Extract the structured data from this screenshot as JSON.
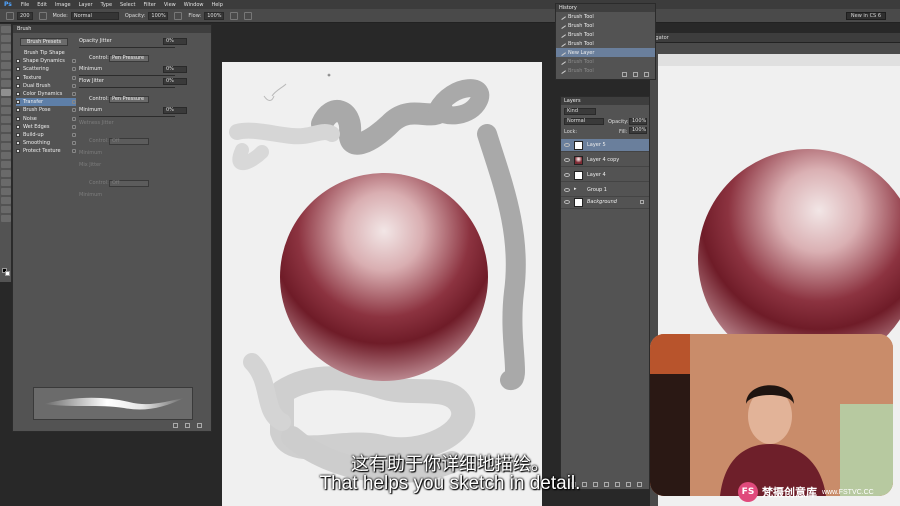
{
  "app": {
    "logo": "Ps",
    "menu": [
      "File",
      "Edit",
      "Image",
      "Layer",
      "Type",
      "Select",
      "Filter",
      "View",
      "Window",
      "Help"
    ]
  },
  "options_bar": {
    "brush_size": "200",
    "mode_label": "Mode:",
    "mode_value": "Normal",
    "opacity_label": "Opacity:",
    "opacity_value": "100%",
    "flow_label": "Flow:",
    "flow_value": "100%",
    "workspace": "New in CS 6"
  },
  "brush_panel": {
    "title": "Brush",
    "presets_button": "Brush Presets",
    "options": [
      {
        "label": "Brush Tip Shape",
        "header": true
      },
      {
        "label": "Shape Dynamics",
        "checked": true
      },
      {
        "label": "Scattering",
        "checked": false
      },
      {
        "label": "Texture",
        "checked": false
      },
      {
        "label": "Dual Brush",
        "checked": false
      },
      {
        "label": "Color Dynamics",
        "checked": false
      },
      {
        "label": "Transfer",
        "checked": true,
        "selected": true
      },
      {
        "label": "Brush Pose",
        "checked": false
      },
      {
        "label": "Noise",
        "checked": false
      },
      {
        "label": "Wet Edges",
        "checked": false
      },
      {
        "label": "Build-up",
        "checked": false
      },
      {
        "label": "Smoothing",
        "checked": true
      },
      {
        "label": "Protect Texture",
        "checked": false
      }
    ],
    "settings": {
      "opacity_jitter_label": "Opacity Jitter",
      "opacity_jitter_value": "0%",
      "control_label": "Control:",
      "control_value": "Pen Pressure",
      "minimum_label": "Minimum",
      "minimum_value": "0%",
      "flow_jitter_label": "Flow Jitter",
      "flow_jitter_value": "0%",
      "control2_label": "Control:",
      "control2_value": "Pen Pressure",
      "minimum2_label": "Minimum",
      "minimum2_value": "0%",
      "wetness_jitter_label": "Wetness Jitter",
      "control3_label": "Control:",
      "control3_value": "Off",
      "minimum3_label": "Minimum",
      "mix_jitter_label": "Mix Jitter",
      "control4_label": "Control:",
      "control4_value": "Off",
      "minimum4_label": "Minimum"
    }
  },
  "history_panel": {
    "title": "History",
    "items": [
      {
        "label": "Brush Tool",
        "state": "normal"
      },
      {
        "label": "Brush Tool",
        "state": "normal"
      },
      {
        "label": "Brush Tool",
        "state": "normal"
      },
      {
        "label": "Brush Tool",
        "state": "normal"
      },
      {
        "label": "New Layer",
        "state": "selected"
      },
      {
        "label": "Brush Tool",
        "state": "undone"
      },
      {
        "label": "Brush Tool",
        "state": "undone"
      }
    ]
  },
  "layers_panel": {
    "title": "Layers",
    "filter": "Kind",
    "blend_mode": "Normal",
    "opacity_label": "Opacity:",
    "opacity_value": "100%",
    "lock_label": "Lock:",
    "fill_label": "Fill:",
    "fill_value": "100%",
    "layers": [
      {
        "name": "Layer 5",
        "selected": true,
        "thumb": "white"
      },
      {
        "name": "Layer 4 copy",
        "selected": false,
        "thumb": "sphere"
      },
      {
        "name": "Layer 4",
        "selected": false,
        "thumb": "strokes"
      },
      {
        "name": "Group 1",
        "selected": false,
        "thumb": "folder"
      },
      {
        "name": "Background",
        "selected": false,
        "thumb": "white",
        "italic": true
      }
    ]
  },
  "doc2": {
    "tab_label": "igator"
  },
  "subtitles": {
    "chinese": "这有助于你详细地描绘。",
    "english": "That helps you sketch in detail."
  },
  "watermark": {
    "logo": "FS",
    "brand": "梵摄创意库",
    "url": "www.FSTVC.CC"
  },
  "colors": {
    "sphere_light": "#f1e4e4",
    "sphere_dark": "#7a1f2b",
    "stroke_gray": "#a8a8a8",
    "canvas": "#f0f0f0",
    "panel": "#535353",
    "selection": "#6a7f9c"
  }
}
